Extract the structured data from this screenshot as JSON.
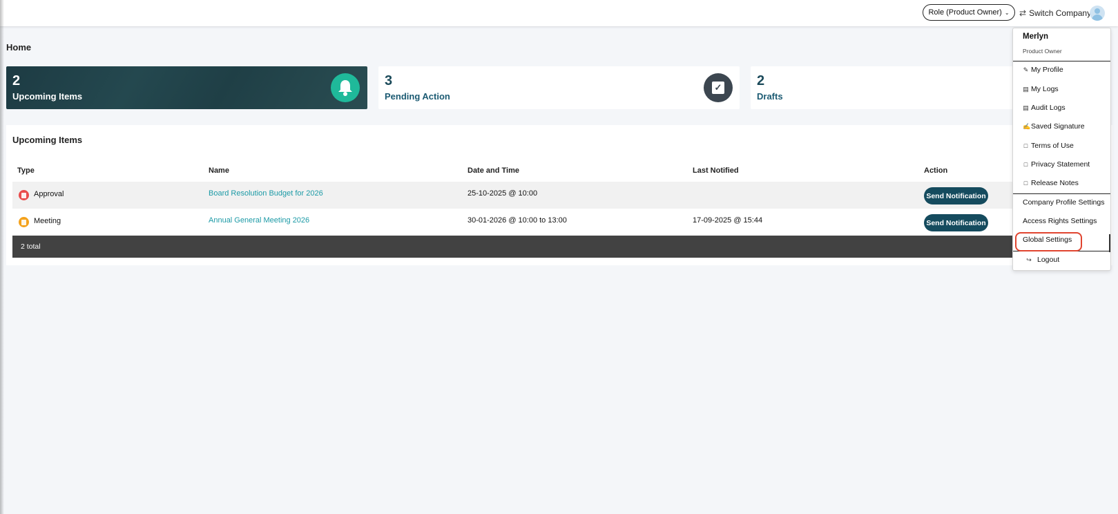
{
  "topbar": {
    "role_label": "Role (Product Owner)",
    "switch_company_label": "Switch Company"
  },
  "page": {
    "title": "Home"
  },
  "cards": [
    {
      "count": "2",
      "label": "Upcoming Items",
      "icon": "bell-icon"
    },
    {
      "count": "3",
      "label": "Pending Action",
      "icon": "check-icon"
    },
    {
      "count": "2",
      "label": "Drafts"
    }
  ],
  "upcoming": {
    "title": "Upcoming Items",
    "columns": [
      "Type",
      "Name",
      "Date and Time",
      "Last Notified",
      "Action"
    ],
    "rows": [
      {
        "type": "Approval",
        "type_icon": "approval-icon",
        "name": "Board Resolution Budget for 2026",
        "datetime": "25-10-2025 @ 10:00",
        "last_notified": "",
        "action": "Send Notification"
      },
      {
        "type": "Meeting",
        "type_icon": "meeting-icon",
        "name": "Annual General Meeting 2026",
        "datetime": "30-01-2026 @ 10:00 to 13:00",
        "last_notified": "17-09-2025 @ 15:44",
        "action": "Send Notification"
      }
    ],
    "footer_total": "2 total"
  },
  "user_menu": {
    "name": "Merlyn",
    "role": "Product Owner",
    "items": [
      {
        "label": "My Profile",
        "icon": "edit-icon"
      },
      {
        "label": "My Logs",
        "icon": "document-icon"
      },
      {
        "label": "Audit Logs",
        "icon": "document-icon"
      },
      {
        "label": "Saved Signature",
        "icon": "signature-icon"
      },
      {
        "label": "Terms of Use",
        "icon": "file-icon"
      },
      {
        "label": "Privacy Statement",
        "icon": "file-icon"
      },
      {
        "label": "Release Notes",
        "icon": "file-icon"
      },
      {
        "label": "Company Profile Settings"
      },
      {
        "label": "Access Rights Settings"
      },
      {
        "label": "Global Settings"
      },
      {
        "label": "Logout",
        "icon": "logout-icon"
      }
    ]
  },
  "colors": {
    "accent_dark": "#154b5e",
    "link": "#1c9aa6",
    "bell_green": "#1fb99a",
    "highlight": "#e0442f"
  }
}
